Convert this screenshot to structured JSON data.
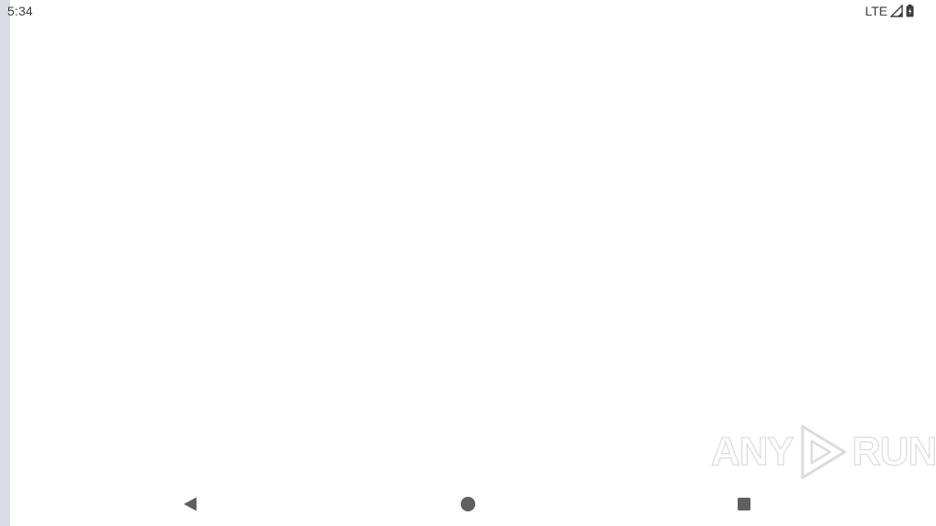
{
  "status_bar": {
    "time": "5:34",
    "network": "LTE",
    "signal_icon": "signal-icon",
    "battery_icon": "battery-icon"
  },
  "watermark": {
    "text_left": "ANY",
    "text_right": "RUN",
    "logo_icon": "play-triangle-icon"
  },
  "nav_bar": {
    "back_icon": "back-triangle-icon",
    "home_icon": "home-circle-icon",
    "recents_icon": "recents-square-icon"
  },
  "colors": {
    "background": "#ffffff",
    "status_text": "#3c3c3c",
    "nav_icon": "#5f5f5f",
    "left_edge": "#d7dde3"
  }
}
